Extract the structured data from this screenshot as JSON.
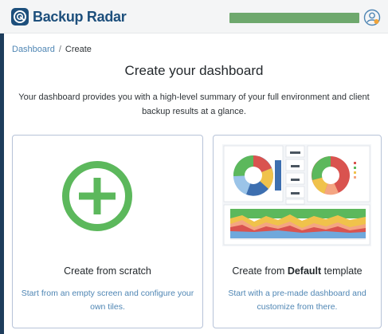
{
  "brand": {
    "name": "Backup Radar"
  },
  "breadcrumb": {
    "root": "Dashboard",
    "separator": "/",
    "current": "Create"
  },
  "page": {
    "title": "Create your dashboard",
    "subtitle": "Your dashboard provides you with a high-level summary of your full environment and client backup results at a glance."
  },
  "cards": {
    "scratch": {
      "title": "Create from scratch",
      "description": "Start from an empty screen and configure your own tiles."
    },
    "template": {
      "title_prefix": "Create from ",
      "title_bold": "Default",
      "title_suffix": " template",
      "description": "Start with a pre-made dashboard and customize from there."
    }
  },
  "colors": {
    "brand": "#1d4f7c",
    "accent_green": "#5cb85c",
    "link_blue": "#4f86b4",
    "card_border": "#b7c3d8"
  },
  "icons": {
    "logo": "radar-logo-icon",
    "avatar": "user-avatar-icon",
    "plus": "plus-circle-icon"
  }
}
